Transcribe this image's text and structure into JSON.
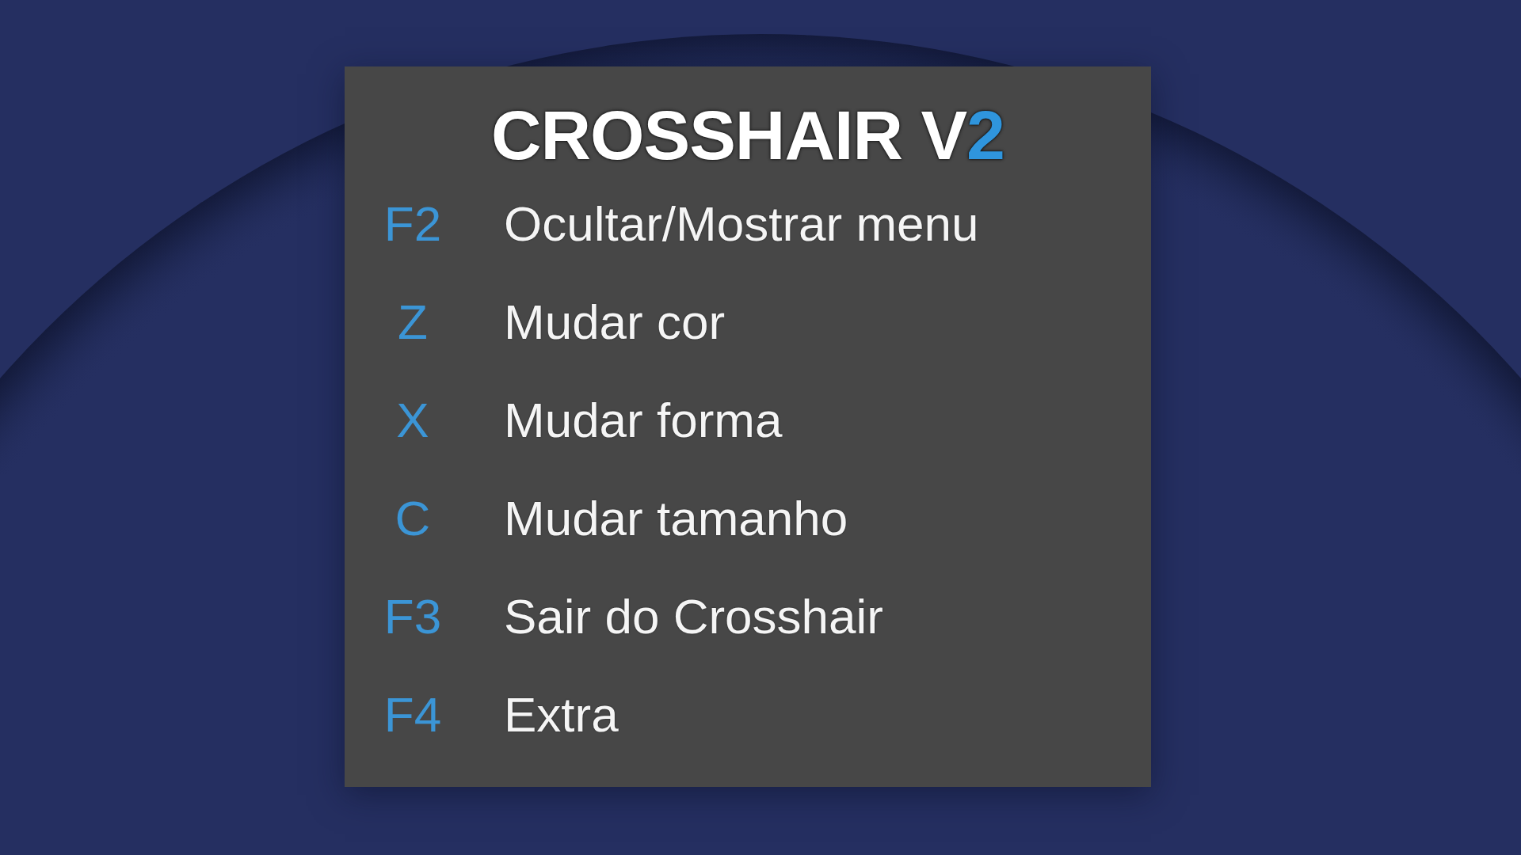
{
  "title": {
    "text": "CROSSHAIR V",
    "highlight": "2"
  },
  "shortcuts": [
    {
      "key": "F2",
      "label": "Ocultar/Mostrar menu"
    },
    {
      "key": "Z",
      "label": "Mudar cor"
    },
    {
      "key": "X",
      "label": "Mudar forma"
    },
    {
      "key": "C",
      "label": "Mudar tamanho"
    },
    {
      "key": "F3",
      "label": "Sair do Crosshair"
    },
    {
      "key": "F4",
      "label": "Extra"
    }
  ]
}
